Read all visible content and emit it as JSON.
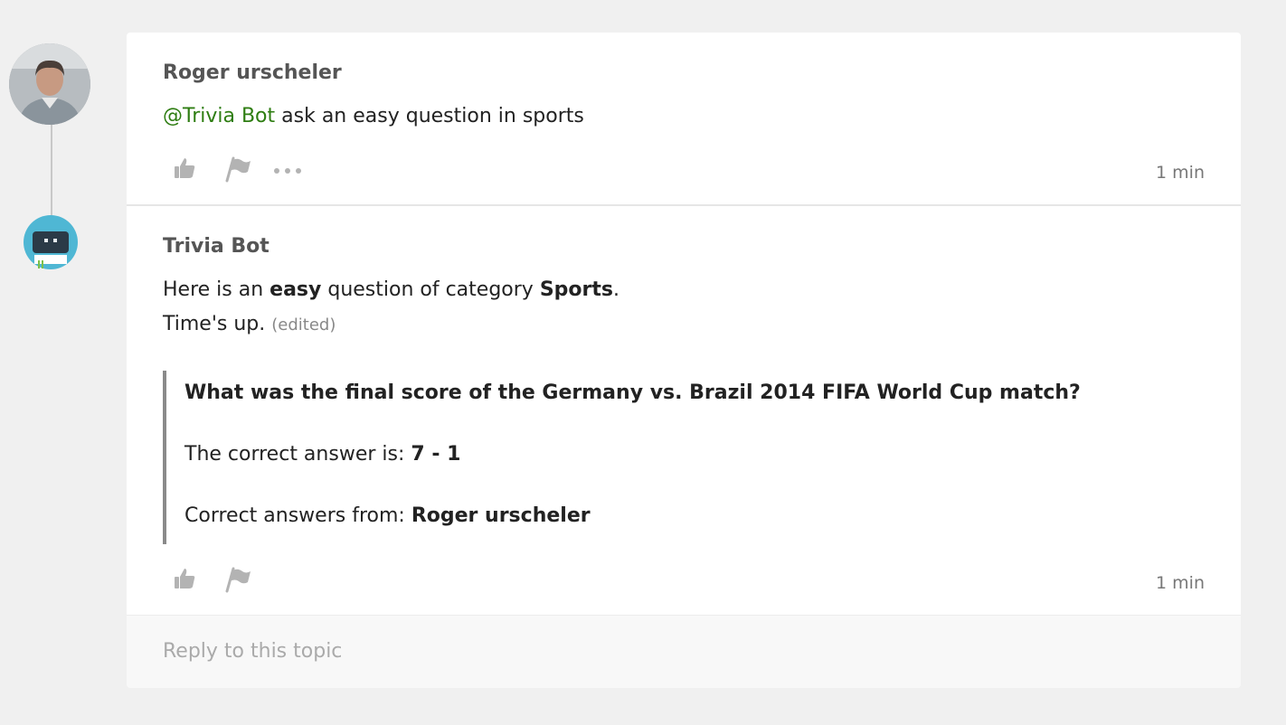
{
  "posts": [
    {
      "author": "Roger urscheler",
      "mention": "@Trivia Bot",
      "body": " ask an easy question in sports",
      "time": "1 min"
    },
    {
      "author": "Trivia Bot",
      "line1_pre": "Here is an ",
      "line1_bold1": "easy",
      "line1_mid": " question of category ",
      "line1_bold2": "Sports",
      "line1_post": ".",
      "line2": "Time's up.",
      "edited": "(edited)",
      "quote": {
        "question": "What was the final score of the Germany vs. Brazil 2014 FIFA World Cup match?",
        "answer_label": "The correct answer is: ",
        "answer_value": "7 - 1",
        "winners_label": "Correct answers from: ",
        "winners_value": "Roger urscheler"
      },
      "time": "1 min"
    }
  ],
  "reply": {
    "placeholder": "Reply to this topic"
  },
  "icons": [
    "like-icon",
    "flag-icon",
    "more-icon"
  ],
  "colors": {
    "mention": "#2e7d12",
    "bot_accent": "#4fb7d4"
  }
}
